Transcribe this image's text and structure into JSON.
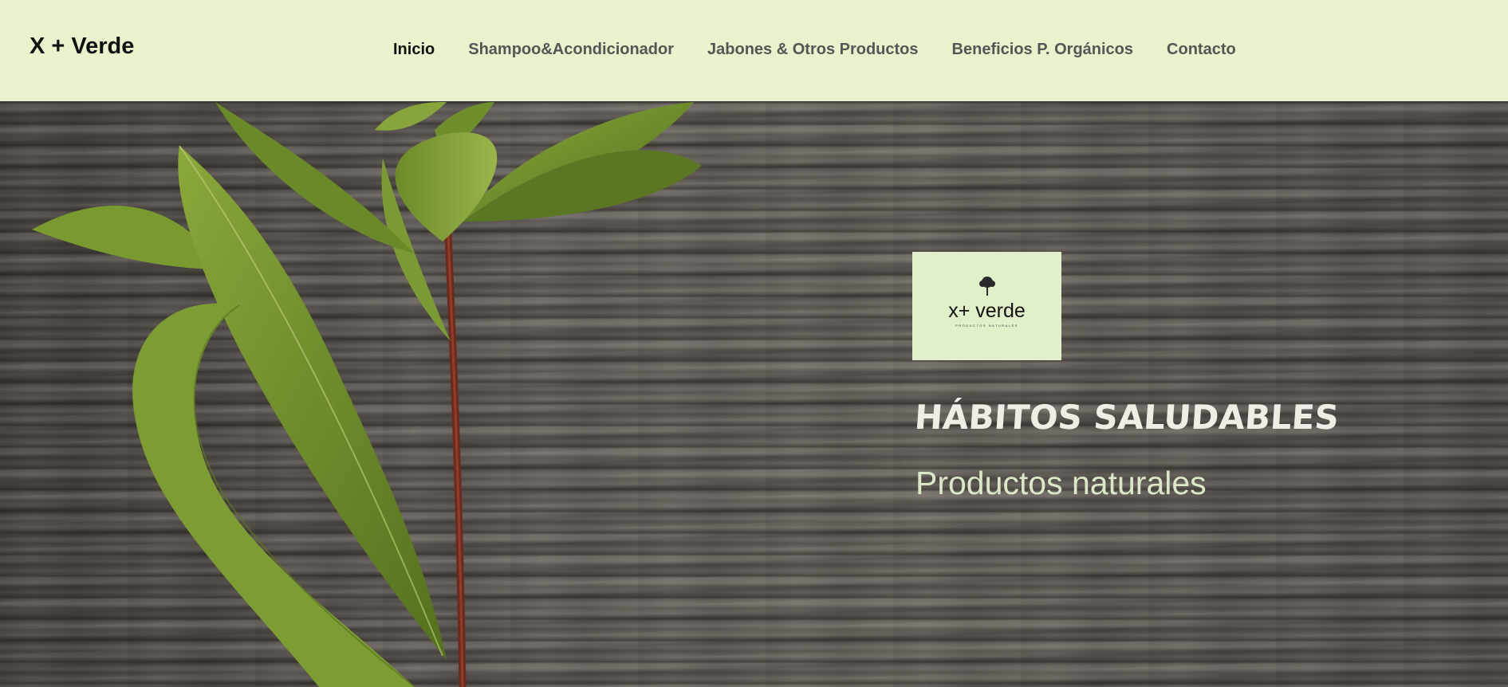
{
  "brand": "X + Verde",
  "nav": {
    "items": [
      {
        "label": "Inicio",
        "active": true
      },
      {
        "label": "Shampoo&Acondicionador",
        "active": false
      },
      {
        "label": "Jabones & Otros Productos",
        "active": false
      },
      {
        "label": "Beneficios P. Orgánicos",
        "active": false
      },
      {
        "label": "Contacto",
        "active": false
      }
    ]
  },
  "hero": {
    "logo": {
      "text": "x+ verde",
      "subtext": "PRODUCTOS NATURALES",
      "icon": "tree-icon"
    },
    "title": "HÁBITOS SALUDABLES",
    "subtitle": "Productos naturales",
    "background": "wood-texture-with-leaves"
  },
  "colors": {
    "navbar_bg": "#e6f3cc",
    "logo_bg": "#e0f0c8",
    "title": "#f1ede6",
    "subtitle": "#dbe8c8",
    "leaf": "#6f8f2c"
  }
}
